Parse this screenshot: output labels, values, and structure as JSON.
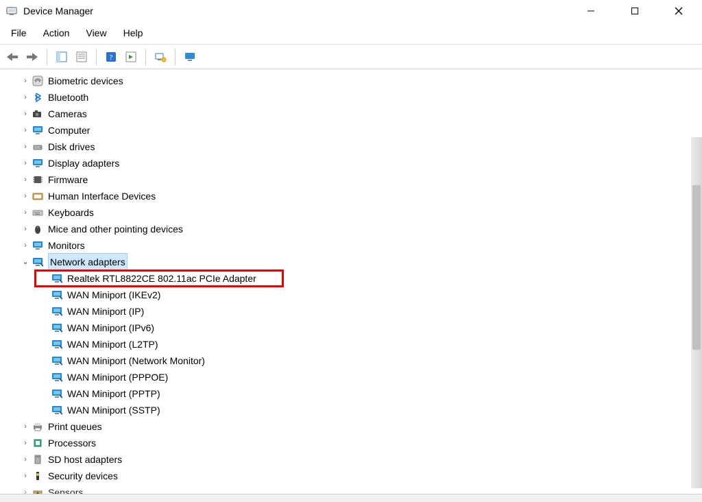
{
  "window": {
    "title": "Device Manager"
  },
  "menu": {
    "file": "File",
    "action": "Action",
    "view": "View",
    "help": "Help"
  },
  "tree": {
    "items": [
      {
        "label": "Biometric devices",
        "icon": "fingerprint"
      },
      {
        "label": "Bluetooth",
        "icon": "bluetooth"
      },
      {
        "label": "Cameras",
        "icon": "camera"
      },
      {
        "label": "Computer",
        "icon": "monitor"
      },
      {
        "label": "Disk drives",
        "icon": "disk"
      },
      {
        "label": "Display adapters",
        "icon": "monitor"
      },
      {
        "label": "Firmware",
        "icon": "chip"
      },
      {
        "label": "Human Interface Devices",
        "icon": "hid"
      },
      {
        "label": "Keyboards",
        "icon": "keyboard"
      },
      {
        "label": "Mice and other pointing devices",
        "icon": "mouse"
      },
      {
        "label": "Monitors",
        "icon": "monitor"
      },
      {
        "label": "Network adapters",
        "icon": "network",
        "expanded": true,
        "selected": true,
        "children": [
          {
            "label": "Realtek RTL8822CE 802.11ac PCIe Adapter",
            "highlighted": true
          },
          {
            "label": "WAN Miniport (IKEv2)"
          },
          {
            "label": "WAN Miniport (IP)"
          },
          {
            "label": "WAN Miniport (IPv6)"
          },
          {
            "label": "WAN Miniport (L2TP)"
          },
          {
            "label": "WAN Miniport (Network Monitor)"
          },
          {
            "label": "WAN Miniport (PPPOE)"
          },
          {
            "label": "WAN Miniport (PPTP)"
          },
          {
            "label": "WAN Miniport (SSTP)"
          }
        ]
      },
      {
        "label": "Print queues",
        "icon": "printer"
      },
      {
        "label": "Processors",
        "icon": "cpu"
      },
      {
        "label": "SD host adapters",
        "icon": "sd"
      },
      {
        "label": "Security devices",
        "icon": "security"
      },
      {
        "label": "Sensors",
        "icon": "sensor",
        "cutoff": true
      }
    ]
  }
}
